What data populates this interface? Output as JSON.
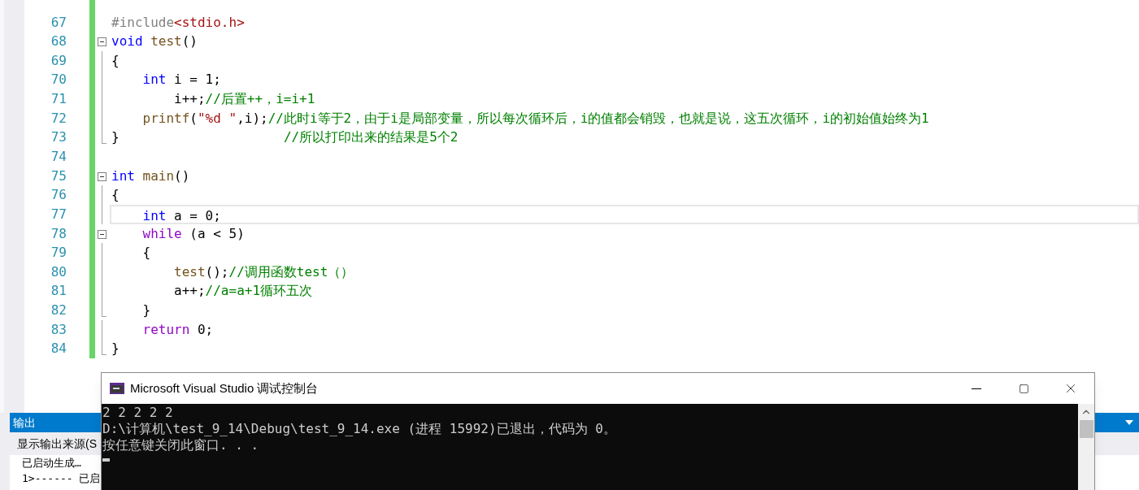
{
  "editor": {
    "lines": [
      {
        "number": "67",
        "modified": true,
        "current": false,
        "kind": "plain",
        "tokens": [
          {
            "text": "#include",
            "kind": "preproc"
          },
          {
            "text": "<stdio.h>",
            "kind": "string"
          }
        ]
      },
      {
        "number": "68",
        "modified": true,
        "current": false,
        "kind": "fold-start",
        "tokens": [
          {
            "text": "void ",
            "kind": "keyword"
          },
          {
            "text": "test",
            "kind": "function"
          },
          {
            "text": "()",
            "kind": "plain"
          }
        ]
      },
      {
        "number": "69",
        "modified": true,
        "current": false,
        "kind": "fold-line",
        "tokens": [
          {
            "text": "{",
            "kind": "plain"
          }
        ]
      },
      {
        "number": "70",
        "modified": true,
        "current": false,
        "kind": "fold-line",
        "tokens": [
          {
            "text": "    int",
            "kind": "keyword"
          },
          {
            "text": " i = 1;",
            "kind": "plain"
          }
        ]
      },
      {
        "number": "71",
        "modified": true,
        "current": false,
        "kind": "fold-line",
        "tokens": [
          {
            "text": "        i++;",
            "kind": "plain"
          },
          {
            "text": "//后置++，i=i+1",
            "kind": "comment"
          }
        ]
      },
      {
        "number": "72",
        "modified": true,
        "current": false,
        "kind": "fold-line",
        "tokens": [
          {
            "text": "    printf",
            "kind": "function"
          },
          {
            "text": "(",
            "kind": "plain"
          },
          {
            "text": "\"%d \"",
            "kind": "string"
          },
          {
            "text": ",i);",
            "kind": "plain"
          },
          {
            "text": "//此时i等于2，由于i是局部变量，所以每次循环后，i的值都会销毁，也就是说，这五次循环，i的初始值始终为1",
            "kind": "comment"
          }
        ]
      },
      {
        "number": "73",
        "modified": true,
        "current": false,
        "kind": "fold-end",
        "tokens": [
          {
            "text": "}                     ",
            "kind": "plain"
          },
          {
            "text": "//所以打印出来的结果是5个2",
            "kind": "comment"
          }
        ]
      },
      {
        "number": "74",
        "modified": true,
        "current": false,
        "kind": "plain"
      },
      {
        "number": "75",
        "modified": true,
        "current": false,
        "kind": "fold-start",
        "tokens": [
          {
            "text": "int ",
            "kind": "keyword"
          },
          {
            "text": "main",
            "kind": "function"
          },
          {
            "text": "()",
            "kind": "plain"
          }
        ]
      },
      {
        "number": "76",
        "modified": true,
        "current": false,
        "kind": "fold-line",
        "tokens": [
          {
            "text": "{",
            "kind": "plain"
          }
        ]
      },
      {
        "number": "77",
        "modified": true,
        "current": true,
        "kind": "fold-line",
        "tokens": [
          {
            "text": "    int",
            "kind": "keyword"
          },
          {
            "text": " a = 0;",
            "kind": "plain"
          }
        ]
      },
      {
        "number": "78",
        "modified": true,
        "current": false,
        "kind": "fold-start",
        "tokens": [
          {
            "text": "    while",
            "kind": "control"
          },
          {
            "text": " (a < 5)",
            "kind": "plain"
          }
        ]
      },
      {
        "number": "79",
        "modified": true,
        "current": false,
        "kind": "fold-line",
        "tokens": [
          {
            "text": "    {",
            "kind": "plain"
          }
        ]
      },
      {
        "number": "80",
        "modified": true,
        "current": false,
        "kind": "fold-line",
        "tokens": [
          {
            "text": "        test",
            "kind": "function"
          },
          {
            "text": "();",
            "kind": "plain"
          },
          {
            "text": "//调用函数test（）",
            "kind": "comment"
          }
        ]
      },
      {
        "number": "81",
        "modified": true,
        "current": false,
        "kind": "fold-line",
        "tokens": [
          {
            "text": "        a++;",
            "kind": "plain"
          },
          {
            "text": "//a=a+1循环五次",
            "kind": "comment"
          }
        ]
      },
      {
        "number": "82",
        "modified": true,
        "current": false,
        "kind": "fold-end",
        "tokens": [
          {
            "text": "    }",
            "kind": "plain"
          }
        ]
      },
      {
        "number": "83",
        "modified": true,
        "current": false,
        "kind": "fold-line",
        "tokens": [
          {
            "text": "    return",
            "kind": "control"
          },
          {
            "text": " 0;",
            "kind": "plain"
          }
        ]
      },
      {
        "number": "84",
        "modified": true,
        "current": false,
        "kind": "fold-end",
        "tokens": [
          {
            "text": "}",
            "kind": "plain"
          }
        ]
      }
    ]
  },
  "output_panel": {
    "title": "输出",
    "source_label": "显示输出来源(S",
    "lines": [
      "已启动生成…",
      "1>------ 已启"
    ]
  },
  "console": {
    "title": "Microsoft Visual Studio 调试控制台",
    "lines": [
      "2 2 2 2 2",
      "D:\\计算机\\test_9_14\\Debug\\test_9_14.exe (进程 15992)已退出，代码为 0。",
      "按任意键关闭此窗口. . ."
    ]
  }
}
